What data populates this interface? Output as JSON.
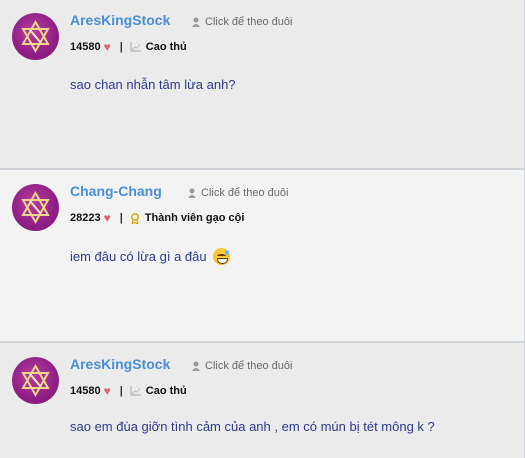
{
  "posts": [
    {
      "username": "AresKingStock",
      "follow_label": "Click để theo đuôi",
      "points": "14580",
      "separator": "|",
      "rank": "Cao thủ",
      "message": "sao chan nhẫn tâm lừa anh?"
    },
    {
      "username": "Chang-Chang",
      "follow_label": "Click để theo đuôi",
      "points": "28223",
      "separator": "|",
      "rank": "Thành viên gạo cội",
      "message": "iem đâu có lừa gì a đâu",
      "emoji": "sweat-smile-emoji"
    },
    {
      "username": "AresKingStock",
      "follow_label": "Click để theo đuôi",
      "points": "14580",
      "separator": "|",
      "rank": "Cao thủ",
      "message": "sao em đùa giỡn tình cảm của anh , em có mún bị tét mông k ?"
    }
  ],
  "colors": {
    "username": "#4a8fd6",
    "message": "#2e3a8c",
    "avatar": "#8f1f85",
    "heart": "#e2607a"
  }
}
